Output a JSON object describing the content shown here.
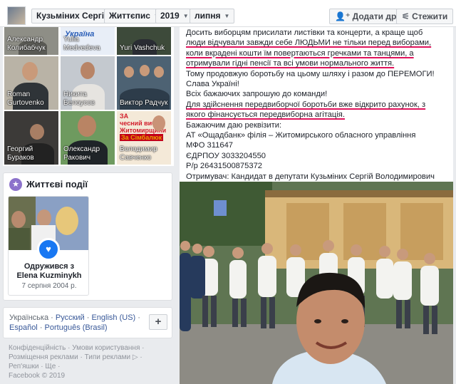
{
  "topbar": {
    "profile_name": "Кузьміних Сергій",
    "crumb_chronicle": "Життєпис",
    "crumb_year": "2019",
    "crumb_month": "липня",
    "add_friend": "Додати друга",
    "follow": "Стежити"
  },
  "friends": [
    {
      "name": "Александр\nКолибабчук"
    },
    {
      "name": "Yulia\nMedvedeva"
    },
    {
      "name": "Yuri Vashchuk"
    },
    {
      "name": "Roman\nGurtovenko"
    },
    {
      "name": "Никита\nБелоусов"
    },
    {
      "name": "Виктор Радчук"
    },
    {
      "name": "Георгий\nБураков"
    },
    {
      "name": "Олександр\nРакович"
    },
    {
      "name": "Володимир\nСавченко"
    }
  ],
  "tile_caption": {
    "line1": "ЗА",
    "line2": "чесний вибір",
    "line3": "Житомирщини",
    "line4": "За Сімбалюк"
  },
  "life_events": {
    "title": "Життєві події",
    "event_title_1": "Одружився з",
    "event_title_2": "Elena Kuzminykh",
    "event_date": "7 серпня 2004 р."
  },
  "languages": {
    "items": [
      "Українська",
      "Русский",
      "English (US)",
      "Español",
      "Português (Brasil)"
    ],
    "add": "+"
  },
  "footer": {
    "line1": "Конфіденційність · Умови користування ·",
    "line2": "Розміщення реклами · Типи реклами ▷ ·",
    "line3": "Реп'яшки · Ще ·",
    "line4": "Facebook © 2019"
  },
  "post": {
    "lines": [
      "Досить виборцям присилати листівки та концерти, а краще щоб",
      "люди відчували завжди себе ЛЮДЬМИ не тільки перед виборами,",
      "коли вкрадені кошти їм повертаються гречками та танцями, а",
      "отримували гідні пенсії та всі умови нормального життя.",
      "Тому продовжую боротьбу на цьому шляху і разом до ПЕРЕМОГИ!",
      "Слава Україні!",
      "Всіх бажаючих запрошую до команди!",
      "Для здійснення передвиборчої боротьби вже відкрито рахунок, з",
      "якого фінансується передвиборна агітація.",
      "Бажаючим даю реквізити:",
      "АТ «Ощадбанк» філія – Житомирського обласного управління",
      "МФО 311647",
      "ЄДРПОУ 3033204550",
      "Р/р 26431500875372",
      "Отримувач: Кандидат в депутати Кузьміних Сергій Володимирович"
    ]
  },
  "colors": {
    "link": "#385898",
    "underline": "#e0135b",
    "life_icon": "#8c72cb"
  }
}
